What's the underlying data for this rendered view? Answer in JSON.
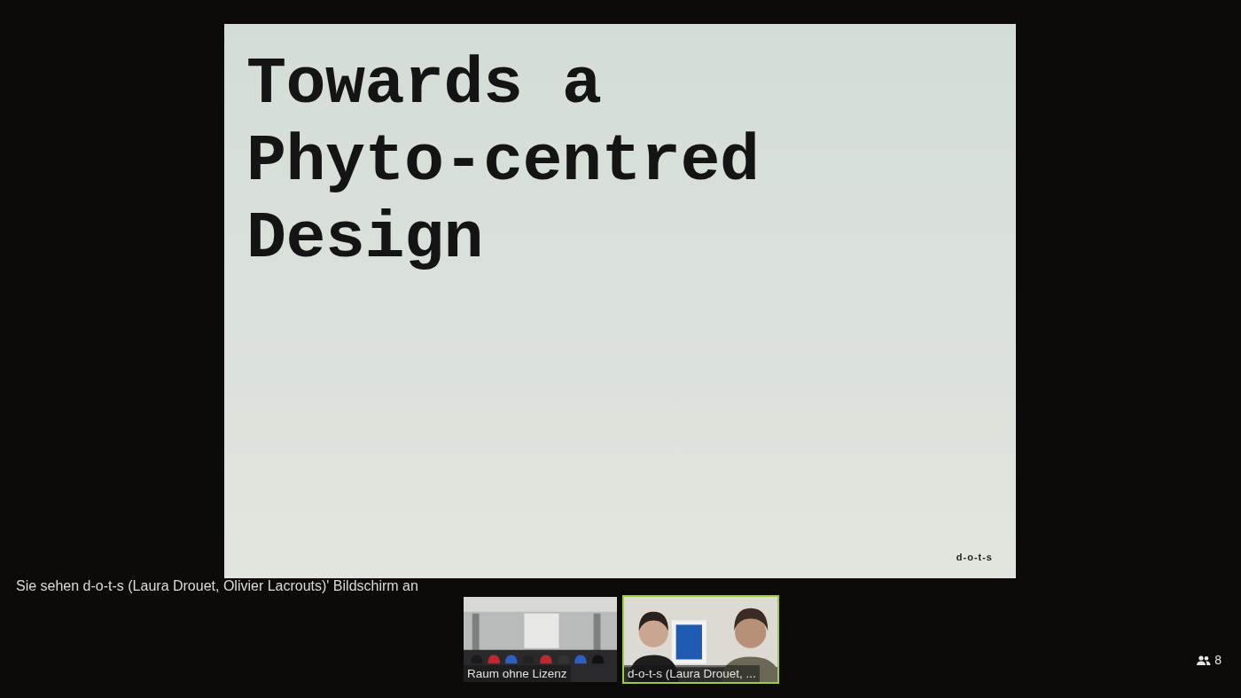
{
  "slide": {
    "title": "Towards a\nPhyto-centred\nDesign",
    "logo": "d-o-t-s"
  },
  "share_notice": "Sie sehen d-o-t-s (Laura Drouet, Olivier Lacrouts)' Bildschirm an",
  "video_tiles": [
    {
      "name": "Raum ohne Lizenz",
      "speaking": false
    },
    {
      "name": "d-o-t-s (Laura Drouet, ...",
      "speaking": true
    }
  ],
  "participants": {
    "count": "8"
  }
}
